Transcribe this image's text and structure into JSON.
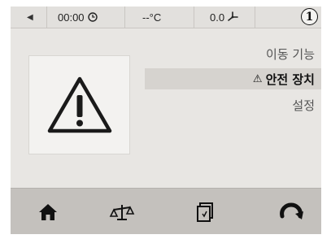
{
  "status_bar": {
    "time": "00:00",
    "temperature": "--°C",
    "fan_value": "0.0"
  },
  "callout_marker": "1",
  "menu": {
    "items": [
      {
        "label": "이동 기능",
        "selected": false
      },
      {
        "label": "안전 장치",
        "selected": true
      },
      {
        "label": "설정",
        "selected": false
      }
    ],
    "selected_prefix": "⚠"
  },
  "icons": [
    "back-arrow-icon",
    "clock-icon",
    "fan-icon",
    "warning-triangle-icon",
    "home-icon",
    "balance-scale-icon",
    "cards-icon",
    "rotate-icon"
  ],
  "colors": {
    "screen_background": "#e8e6e3",
    "bottom_bar": "#c4c1bd",
    "selected_row": "#d6d3cf"
  }
}
